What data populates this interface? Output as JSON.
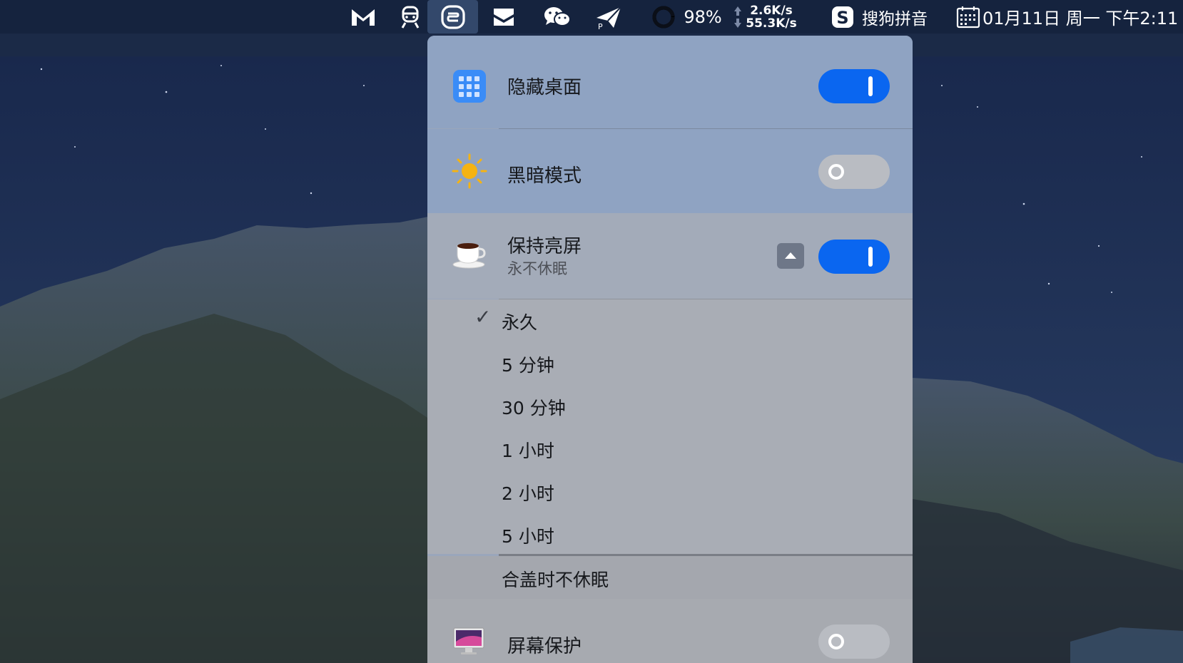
{
  "menubar": {
    "battery_percent": "98%",
    "net_up": "2.6K/s",
    "net_down": "55.3K/s",
    "ime_label": "搜狗拼音",
    "clock": "01月11日 周一 下午2:11",
    "icons": [
      "gmail-icon",
      "train-icon",
      "app-icon",
      "inbox-icon",
      "wechat-icon",
      "paper-plane-icon",
      "battery-ring-icon",
      "network-arrows-icon",
      "sogou-icon",
      "calendar-icon"
    ]
  },
  "panel": {
    "items": [
      {
        "label": "隐藏桌面",
        "icon": "grid-icon",
        "toggle": "on"
      },
      {
        "label": "黑暗模式",
        "icon": "sun-icon",
        "toggle": "off"
      },
      {
        "label": "保持亮屏",
        "sublabel": "永不休眠",
        "icon": "coffee-cup-icon",
        "toggle": "on",
        "expanded": true
      },
      {
        "label": "屏幕保护",
        "icon": "monitor-icon",
        "toggle": "off"
      }
    ],
    "keep_awake_options": [
      {
        "label": "永久",
        "checked": true
      },
      {
        "label": "5 分钟",
        "checked": false
      },
      {
        "label": "30 分钟",
        "checked": false
      },
      {
        "label": "1 小时",
        "checked": false
      },
      {
        "label": "2 小时",
        "checked": false
      },
      {
        "label": "5 小时",
        "checked": false
      }
    ],
    "lid_option": "合盖时不休眠",
    "check_glyph": "✓"
  },
  "colors": {
    "accent": "#0a66f0",
    "menubar": "#15233e"
  }
}
